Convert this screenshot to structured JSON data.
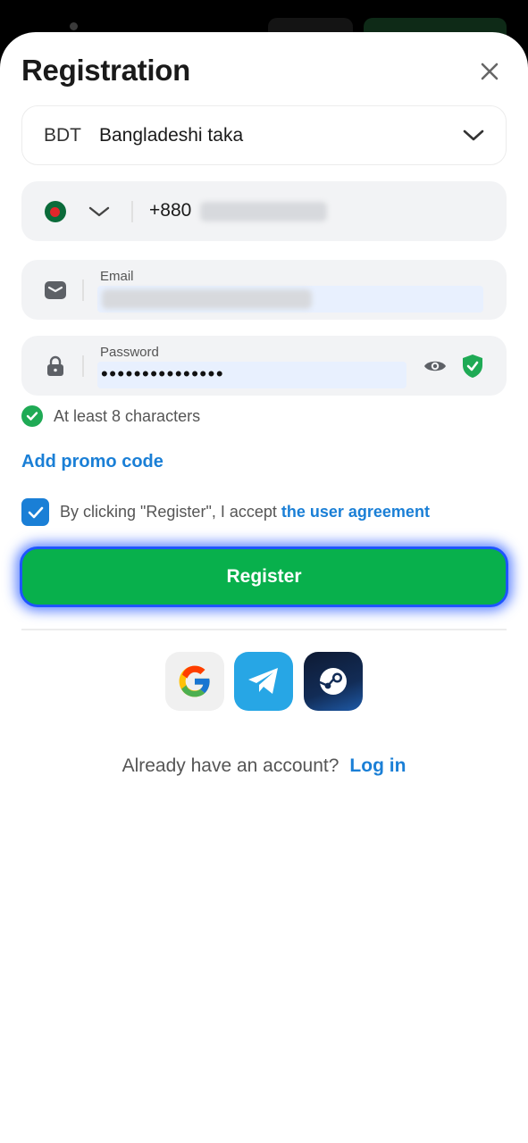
{
  "colors": {
    "accent": "#1a7fd6",
    "register_button": "#08b04c",
    "success": "#1faa55",
    "field_bg": "#f2f3f5"
  },
  "header": {
    "title": "Registration",
    "close_icon": "close-icon"
  },
  "currency": {
    "code": "BDT",
    "name": "Bangladeshi taka",
    "chevron_icon": "chevron-down-icon"
  },
  "phone": {
    "flag_icon": "bangladesh-flag-icon",
    "prefix": "+880"
  },
  "email": {
    "label": "Email",
    "icon": "mail-icon"
  },
  "password": {
    "label": "Password",
    "value": "•••••••••••••••",
    "icon": "lock-icon",
    "visibility_icon": "eye-icon",
    "strength_icon": "shield-check-icon"
  },
  "validation": {
    "rule": "At least 8 characters"
  },
  "promo": {
    "label": "Add promo code"
  },
  "agreement": {
    "text": "By clicking \"Register\", I accept",
    "link": "the user agreement",
    "checked": true
  },
  "register": {
    "label": "Register"
  },
  "social": [
    "google-icon",
    "telegram-icon",
    "steam-icon"
  ],
  "login": {
    "prompt": "Already have an account?",
    "link": "Log in"
  }
}
